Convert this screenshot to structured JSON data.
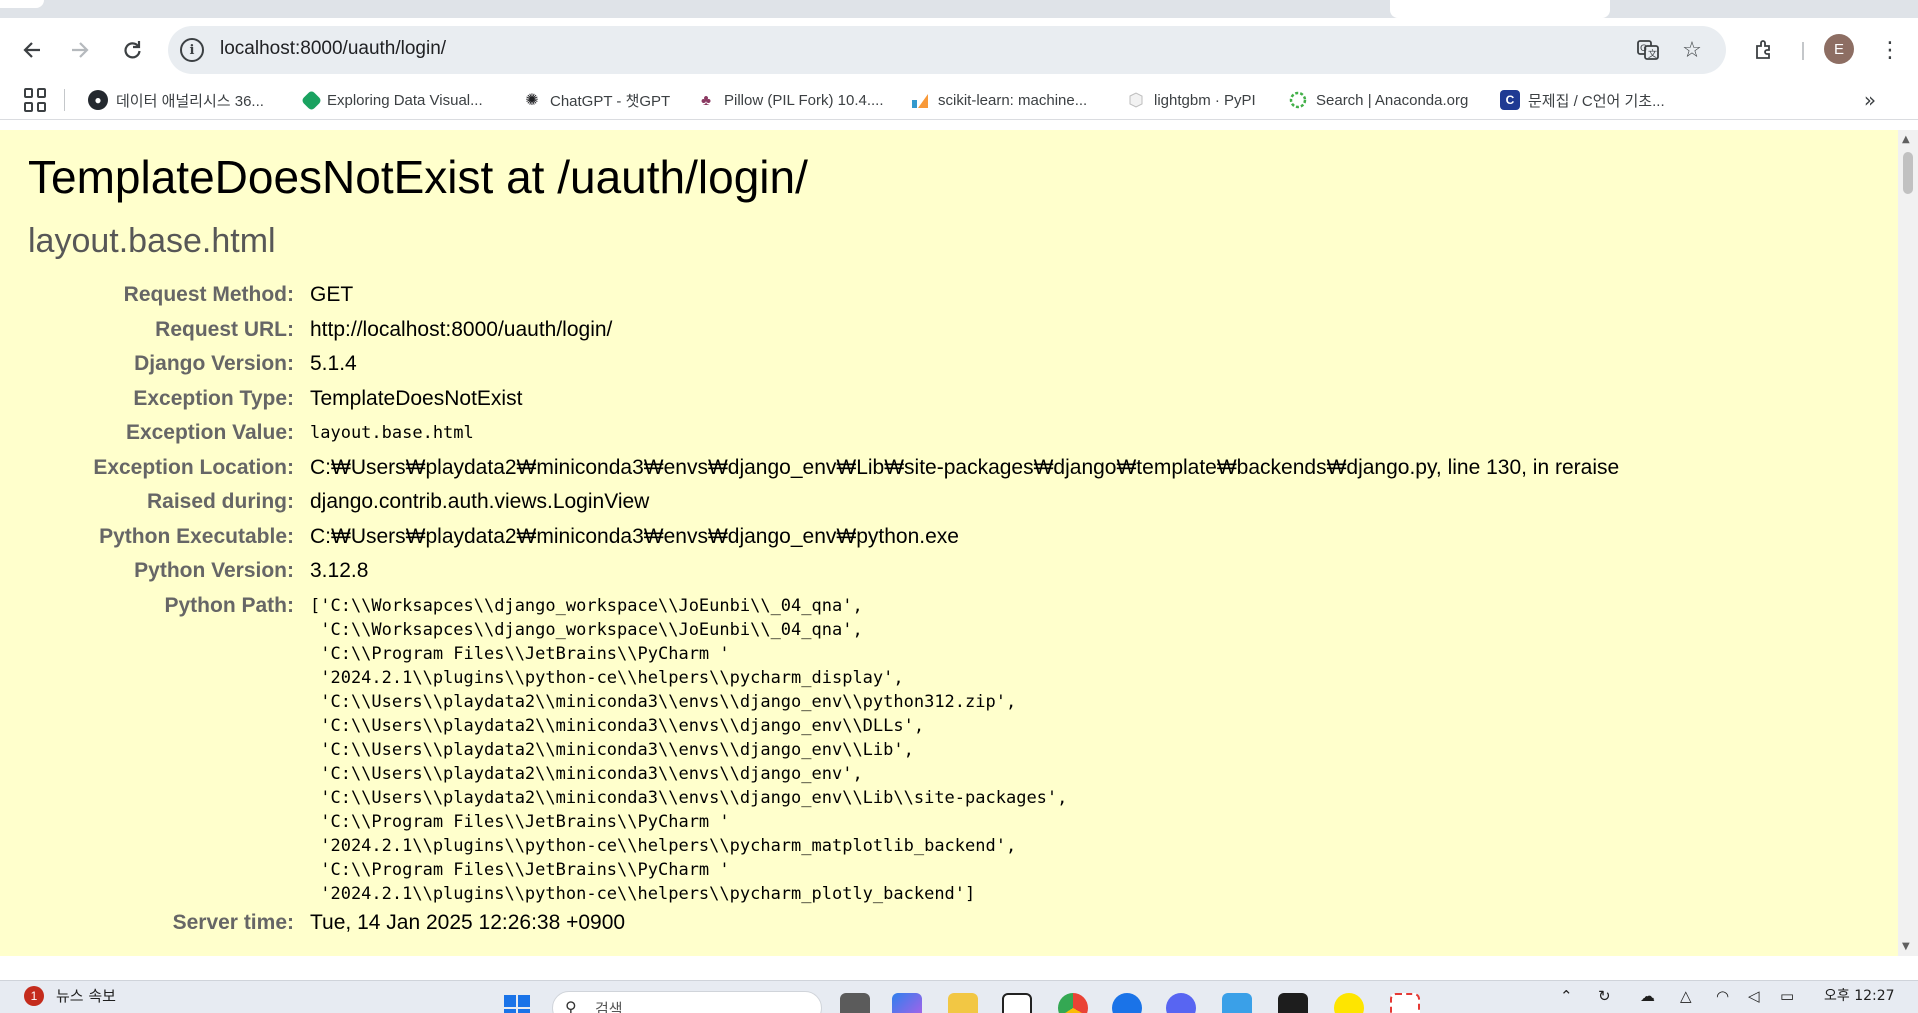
{
  "browser": {
    "url": "localhost:8000/uauth/login/",
    "profile_initial": "E",
    "bookmarks": [
      {
        "label": "데이터 애널리시스 36...",
        "icon": "github-icon"
      },
      {
        "label": "Exploring Data Visual...",
        "icon": "green-diamond-icon"
      },
      {
        "label": "ChatGPT - 챗GPT",
        "icon": "openai-icon"
      },
      {
        "label": "Pillow (PIL Fork) 10.4....",
        "icon": "pillow-icon"
      },
      {
        "label": "scikit-learn: machine...",
        "icon": "sklearn-icon"
      },
      {
        "label": "lightgbm · PyPI",
        "icon": "pypi-icon"
      },
      {
        "label": "Search | Anaconda.org",
        "icon": "anaconda-icon"
      },
      {
        "label": "문제집 / C언어 기초...",
        "icon": "codeup-icon"
      }
    ]
  },
  "error": {
    "title": "TemplateDoesNotExist at /uauth/login/",
    "subtitle": "layout.base.html",
    "rows": {
      "request_method": {
        "label": "Request Method:",
        "value": "GET"
      },
      "request_url": {
        "label": "Request URL:",
        "value": "http://localhost:8000/uauth/login/"
      },
      "django_version": {
        "label": "Django Version:",
        "value": "5.1.4"
      },
      "exception_type": {
        "label": "Exception Type:",
        "value": "TemplateDoesNotExist"
      },
      "exception_value": {
        "label": "Exception Value:",
        "value": "layout.base.html"
      },
      "exception_location": {
        "label": "Exception Location:",
        "value": "C:₩Users₩playdata2₩miniconda3₩envs₩django_env₩Lib₩site-packages₩django₩template₩backends₩django.py, line 130, in reraise"
      },
      "raised_during": {
        "label": "Raised during:",
        "value": "django.contrib.auth.views.LoginView"
      },
      "python_executable": {
        "label": "Python Executable:",
        "value": "C:₩Users₩playdata2₩miniconda3₩envs₩django_env₩python.exe"
      },
      "python_version": {
        "label": "Python Version:",
        "value": "3.12.8"
      },
      "python_path": {
        "label": "Python Path:",
        "value": "['C:\\\\Worksapces\\\\django_workspace\\\\JoEunbi\\\\_04_qna',\n 'C:\\\\Worksapces\\\\django_workspace\\\\JoEunbi\\\\_04_qna',\n 'C:\\\\Program Files\\\\JetBrains\\\\PyCharm '\n '2024.2.1\\\\plugins\\\\python-ce\\\\helpers\\\\pycharm_display',\n 'C:\\\\Users\\\\playdata2\\\\miniconda3\\\\envs\\\\django_env\\\\python312.zip',\n 'C:\\\\Users\\\\playdata2\\\\miniconda3\\\\envs\\\\django_env\\\\DLLs',\n 'C:\\\\Users\\\\playdata2\\\\miniconda3\\\\envs\\\\django_env\\\\Lib',\n 'C:\\\\Users\\\\playdata2\\\\miniconda3\\\\envs\\\\django_env',\n 'C:\\\\Users\\\\playdata2\\\\miniconda3\\\\envs\\\\django_env\\\\Lib\\\\site-packages',\n 'C:\\\\Program Files\\\\JetBrains\\\\PyCharm '\n '2024.2.1\\\\plugins\\\\python-ce\\\\helpers\\\\pycharm_matplotlib_backend',\n 'C:\\\\Program Files\\\\JetBrains\\\\PyCharm '\n '2024.2.1\\\\plugins\\\\python-ce\\\\helpers\\\\pycharm_plotly_backend']"
      },
      "server_time": {
        "label": "Server time:",
        "value": "Tue, 14 Jan 2025 12:26:38 +0900"
      }
    }
  },
  "taskbar": {
    "news_badge": "1",
    "news_label": "뉴스 속보",
    "search_placeholder": "검색",
    "clock_time": "오후 12:27"
  },
  "colors": {
    "page_background": "#ffffcc",
    "label_color": "#666666",
    "subtitle_color": "#575757"
  }
}
